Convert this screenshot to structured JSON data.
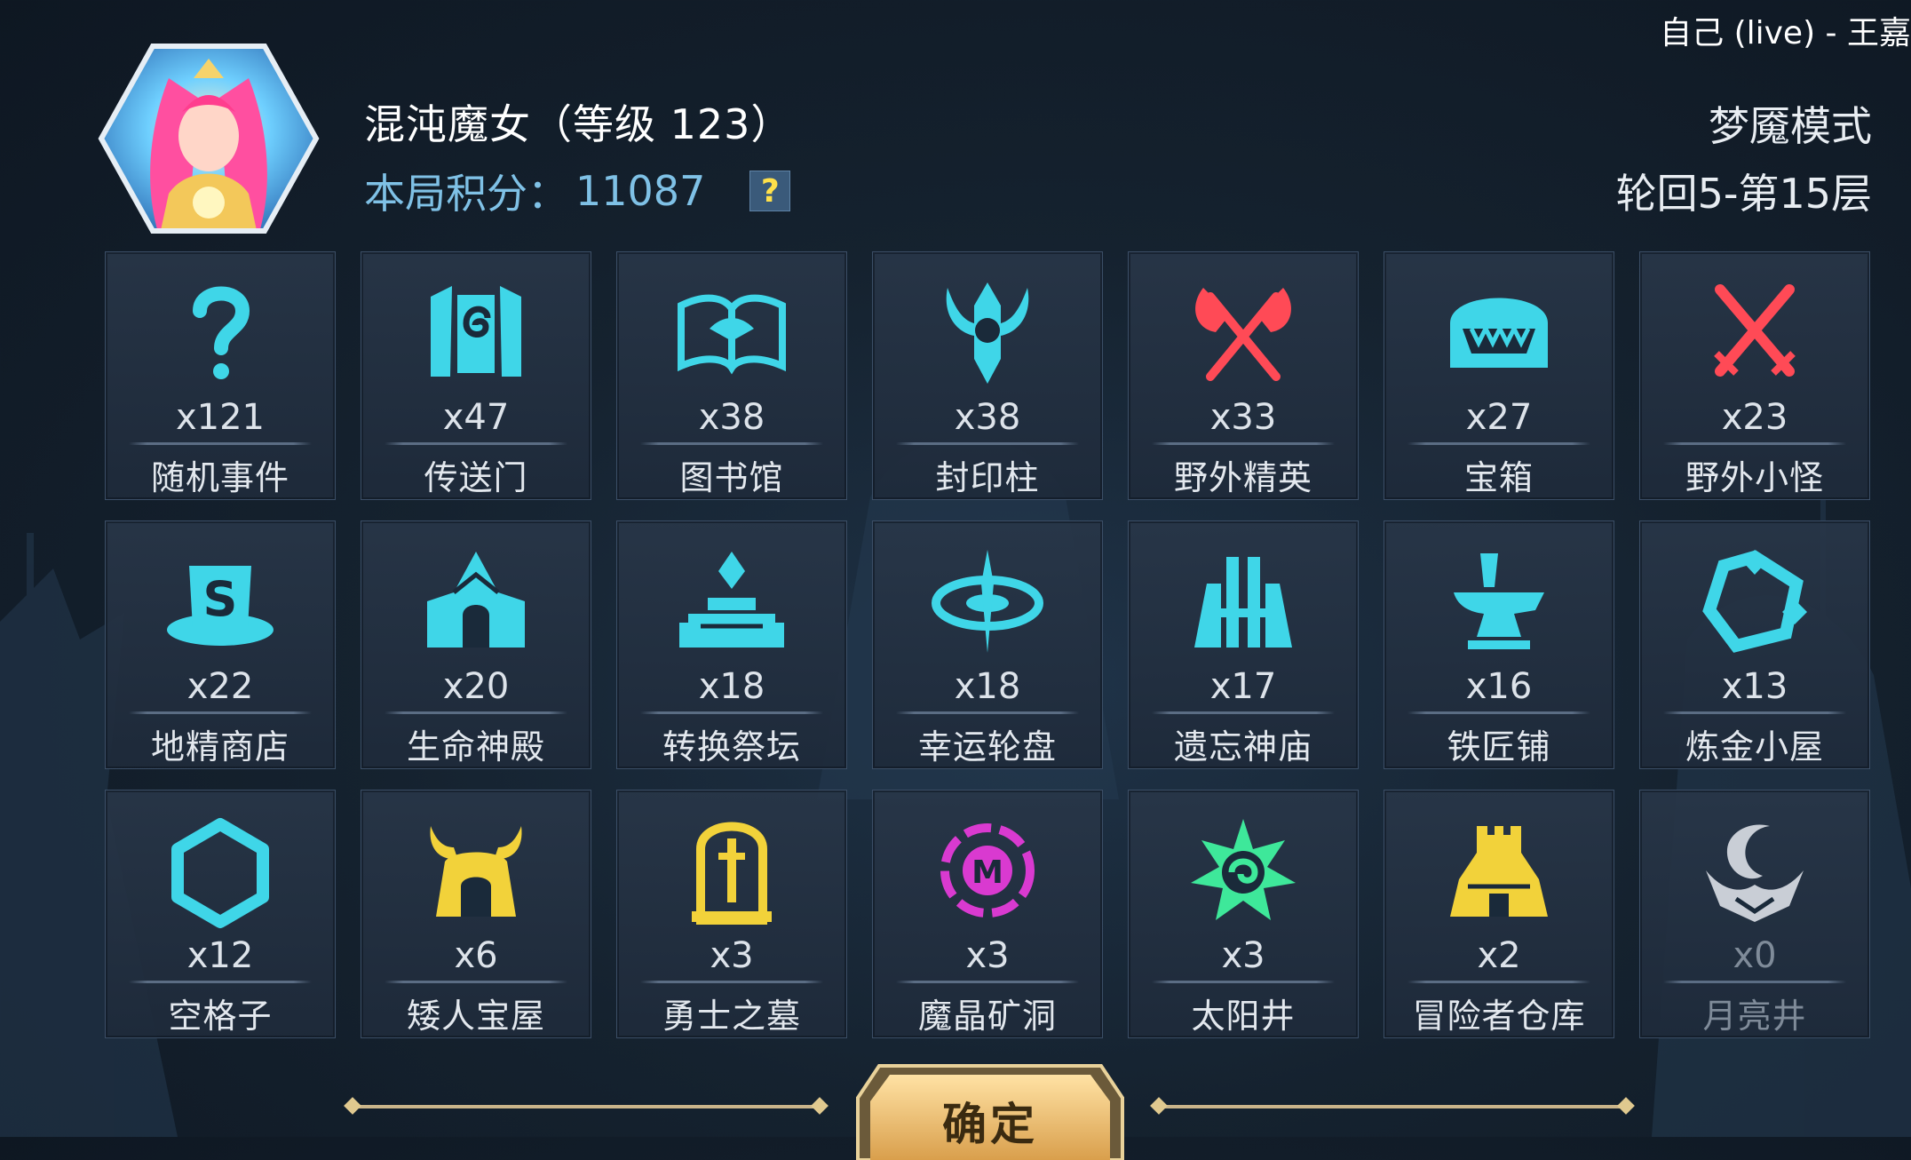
{
  "window_title": "自己 (live) - 王嘉",
  "hero": {
    "name": "混沌魔女（等级 123）",
    "score_label": "本局积分：",
    "score_value": "11087",
    "help_glyph": "?"
  },
  "mode": {
    "title": "梦魇模式",
    "level": "轮回5-第15层"
  },
  "colors": {
    "cyan_icon": "#3fd6e8",
    "red_icon": "#ff4a56",
    "gold_icon": "#f2d23a",
    "purple_icon": "#d93ad0",
    "green_icon": "#3ee89a",
    "grey_icon": "#c9ced6",
    "score_text": "#7fc1e6"
  },
  "tiles": [
    {
      "icon": "question-icon",
      "count": "x121",
      "label": "随机事件"
    },
    {
      "icon": "portal-icon",
      "count": "x47",
      "label": "传送门"
    },
    {
      "icon": "library-book-icon",
      "count": "x38",
      "label": "图书馆"
    },
    {
      "icon": "seal-pillar-icon",
      "count": "x38",
      "label": "封印柱"
    },
    {
      "icon": "crossed-axes-icon",
      "count": "x33",
      "label": "野外精英"
    },
    {
      "icon": "treasure-chest-icon",
      "count": "x27",
      "label": "宝箱"
    },
    {
      "icon": "crossed-swords-icon",
      "count": "x23",
      "label": "野外小怪"
    },
    {
      "icon": "goblin-shop-icon",
      "count": "x22",
      "label": "地精商店"
    },
    {
      "icon": "life-temple-icon",
      "count": "x20",
      "label": "生命神殿"
    },
    {
      "icon": "altar-icon",
      "count": "x18",
      "label": "转换祭坛"
    },
    {
      "icon": "lucky-wheel-icon",
      "count": "x18",
      "label": "幸运轮盘"
    },
    {
      "icon": "forgotten-temple-icon",
      "count": "x17",
      "label": "遗忘神庙"
    },
    {
      "icon": "anvil-icon",
      "count": "x16",
      "label": "铁匠铺"
    },
    {
      "icon": "alchemy-icon",
      "count": "x13",
      "label": "炼金小屋"
    },
    {
      "icon": "hexagon-icon",
      "count": "x12",
      "label": "空格子"
    },
    {
      "icon": "dwarf-treasure-icon",
      "count": "x6",
      "label": "矮人宝屋"
    },
    {
      "icon": "tombstone-icon",
      "count": "x3",
      "label": "勇士之墓"
    },
    {
      "icon": "crystal-mine-icon",
      "count": "x3",
      "label": "魔晶矿洞"
    },
    {
      "icon": "sun-well-icon",
      "count": "x3",
      "label": "太阳井"
    },
    {
      "icon": "warehouse-icon",
      "count": "x2",
      "label": "冒险者仓库"
    },
    {
      "icon": "moon-well-icon",
      "count": "x0",
      "label": "月亮井"
    }
  ],
  "confirm_label": "确定"
}
